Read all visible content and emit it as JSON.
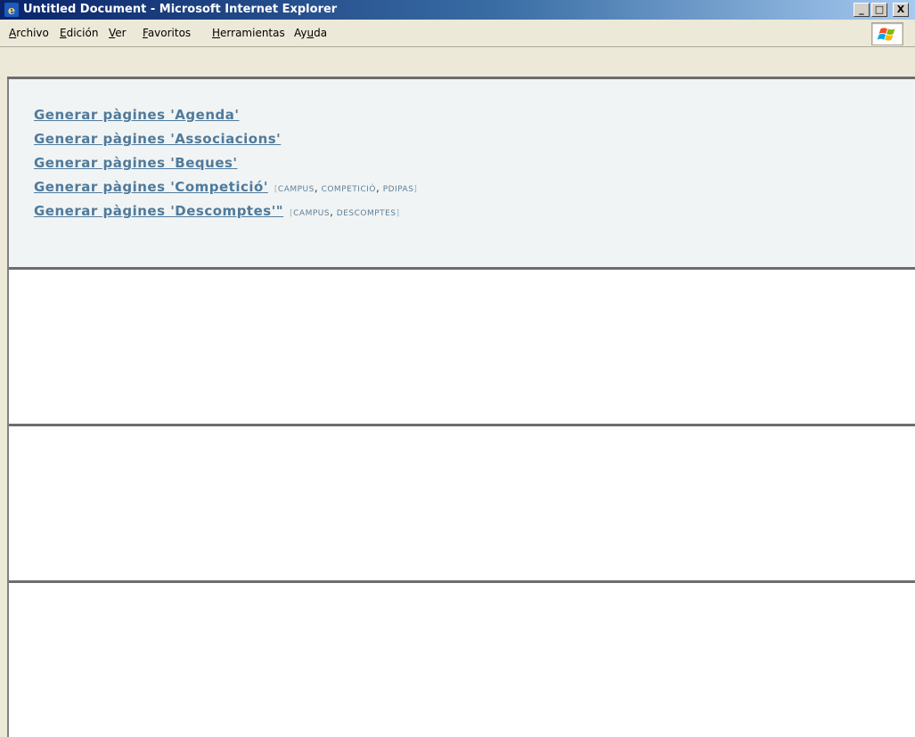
{
  "window": {
    "title": "Untitled Document - Microsoft Internet Explorer",
    "minimize_symbol": "_",
    "maximize_symbol": "□",
    "close_symbol": "X"
  },
  "menu": {
    "items": [
      {
        "accel": "A",
        "rest": "rchivo"
      },
      {
        "accel": "E",
        "rest": "dición"
      },
      {
        "accel": "V",
        "rest": "er"
      },
      {
        "accel": "F",
        "rest": "avoritos"
      },
      {
        "accel": "H",
        "rest": "erramientas"
      },
      {
        "pre": "Ay",
        "accel": "u",
        "rest": "da"
      }
    ]
  },
  "links": [
    {
      "label": "Generar pàgines 'Agenda'"
    },
    {
      "label": "Generar pàgines 'Associacions'"
    },
    {
      "label": "Generar pàgines 'Beques'"
    },
    {
      "label": "Generar pàgines 'Competició'",
      "tags": [
        "campus",
        "competició",
        "pdipas"
      ]
    },
    {
      "label": "Generar pàgines 'Descomptes'\"",
      "tags": [
        "campus",
        "descomptes"
      ]
    }
  ],
  "tag_open": "[",
  "tag_close": "]",
  "tag_separator": ",",
  "colors": {
    "link": "#4f7a9c",
    "frame_border": "#6d6d6d",
    "top_frame_bg": "#f1f4f4"
  }
}
